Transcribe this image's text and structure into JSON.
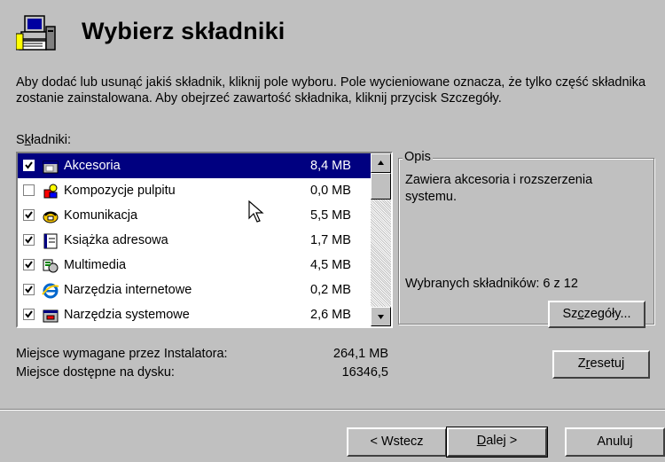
{
  "title": "Wybierz składniki",
  "description": "Aby dodać lub usunąć jakiś składnik, kliknij pole wyboru. Pole wycieniowane oznacza, że tylko część składnika zostanie zainstalowana. Aby obejrzeć zawartość składnika, kliknij przycisk Szczegóły.",
  "components_label_prefix": "S",
  "components_label_accel": "k",
  "components_label_suffix": "ładniki:",
  "components": [
    {
      "name": "Akcesoria",
      "size": "8,4 MB",
      "checked": true,
      "selected": true,
      "icon": "accessories-icon"
    },
    {
      "name": "Kompozycje pulpitu",
      "size": "0,0 MB",
      "checked": false,
      "selected": false,
      "icon": "desktop-themes-icon"
    },
    {
      "name": "Komunikacja",
      "size": "5,5 MB",
      "checked": true,
      "selected": false,
      "icon": "communications-icon"
    },
    {
      "name": "Książka adresowa",
      "size": "1,7 MB",
      "checked": true,
      "selected": false,
      "icon": "address-book-icon"
    },
    {
      "name": "Multimedia",
      "size": "4,5 MB",
      "checked": true,
      "selected": false,
      "icon": "multimedia-icon"
    },
    {
      "name": "Narzędzia internetowe",
      "size": "0,2 MB",
      "checked": true,
      "selected": false,
      "icon": "internet-explorer-icon"
    },
    {
      "name": "Narzędzia systemowe",
      "size": "2,6 MB",
      "checked": true,
      "selected": false,
      "icon": "system-tools-icon"
    }
  ],
  "description_group": {
    "legend": "Opis",
    "text": "Zawiera akcesoria i rozszerzenia systemu.",
    "selected_count": "Wybranych składników: 6 z 12"
  },
  "buttons": {
    "details": {
      "pre": "Sz",
      "accel": "c",
      "post": "zegóły..."
    },
    "reset": {
      "pre": "Z",
      "accel": "r",
      "post": "esetuj"
    },
    "back": "< Wstecz",
    "next": {
      "pre": "",
      "accel": "D",
      "post": "alej >"
    },
    "cancel": "Anuluj"
  },
  "space": {
    "required_label": "Miejsce wymagane przez Instalatora:",
    "required_value": "264,1 MB",
    "available_label": "Miejsce dostępne na dysku:",
    "available_value": "16346,5"
  }
}
